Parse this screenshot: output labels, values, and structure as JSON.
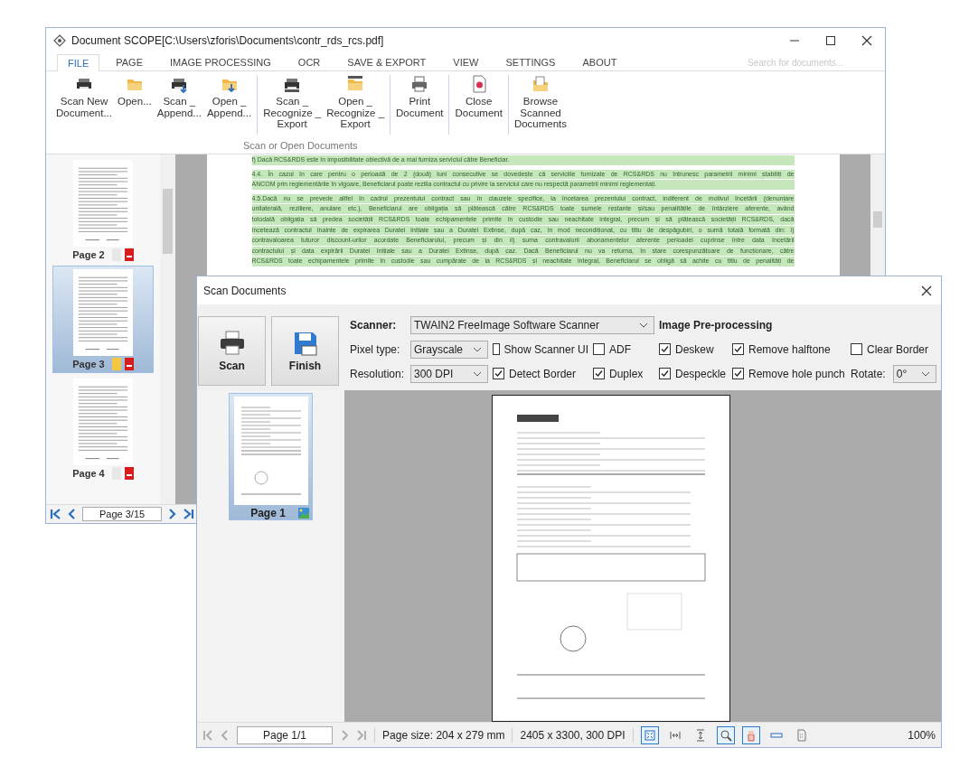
{
  "main_window": {
    "title": "Document SCOPE[C:\\Users\\zforis\\Documents\\contr_rds_rcs.pdf]",
    "tabs": [
      {
        "label": "FILE",
        "selected": true
      },
      {
        "label": "PAGE",
        "selected": false
      },
      {
        "label": "IMAGE PROCESSING",
        "selected": false
      },
      {
        "label": "OCR",
        "selected": false
      },
      {
        "label": "SAVE & EXPORT",
        "selected": false
      },
      {
        "label": "VIEW",
        "selected": false
      },
      {
        "label": "SETTINGS",
        "selected": false
      },
      {
        "label": "ABOUT",
        "selected": false
      }
    ],
    "search": {
      "placeholder": "Search for documents..."
    },
    "ribbon": {
      "caption": "Scan or Open Documents",
      "groups": [
        {
          "buttons": [
            {
              "label": "Scan New\nDocument...",
              "kind": "scanner"
            },
            {
              "label": "Open...",
              "kind": "folder"
            },
            {
              "label": "Scan _\nAppend...",
              "kind": "scanner-append"
            },
            {
              "label": "Open _\nAppend...",
              "kind": "folder-append"
            }
          ]
        },
        {
          "buttons": [
            {
              "label": "Scan _\nRecognize _\nExport",
              "kind": "scanner-numbered"
            },
            {
              "label": "Open _\nRecognize _\nExport",
              "kind": "folder-numbered"
            }
          ]
        },
        {
          "buttons": [
            {
              "label": "Print\nDocument",
              "kind": "printer"
            }
          ]
        },
        {
          "buttons": [
            {
              "label": "Close\nDocument",
              "kind": "close-document"
            }
          ]
        },
        {
          "buttons": [
            {
              "label": "Browse\nScanned\nDocuments",
              "kind": "browse"
            }
          ]
        }
      ]
    },
    "thumbnails": [
      {
        "label": "Page 2",
        "selected": false,
        "ocr_done": false
      },
      {
        "label": "Page 3",
        "selected": true,
        "ocr_done": true
      },
      {
        "label": "Page 4",
        "selected": false,
        "ocr_done": false
      }
    ],
    "page_nav": "Page 3/15",
    "document_lines": [
      {
        "text": "f) Dacă RCS&RDS este în imposibilitate obiectivă de a mai furniza serviciul către Beneficiar.",
        "last": true
      },
      {
        "text": "4.4. În cazul în care pentru o perioadă de 2 (două) luni consecutive se dovedește că serviciile furnizate de RCS&RDS nu întrunesc parametrii minimi stabiliți de",
        "last": false
      },
      {
        "text": "ANCOM prin reglementările în vigoare, Beneficiarul poate rezilia contractul cu privire la serviciul care nu respectă parametrii minimi reglementați.",
        "last": true
      },
      {
        "text": "4.5.Dacă nu se prevede altfel în cadrul prezentului contract sau în clauzele specifice, la încetarea prezentului contract, indiferent de motivul încetării (denunțare",
        "last": false
      },
      {
        "text": "unilaterală, reziliere, anulare etc.), Beneficiarul are obligația să plătească către RCS&RDS toate sumele restante și/sau penalitățile de întârziere aferente, având",
        "last": false
      },
      {
        "text": "totodată obligația să predea societății RCS&RDS toate echipamentele primite în custodie sau neachitate integral, precum și să plătească societății RCS&RDS, dacă",
        "last": false
      },
      {
        "text": "încetează contractul înainte de expirarea Duratei Inițiale sau a Duratei Extinse, după caz, în mod necondiționat, cu titlu de despăgubiri, o sumă totală formată din: i)",
        "last": false
      },
      {
        "text": "contravaloarea tuturor discount-urilor acordate Beneficiarului, precum și din ii) suma contravalorii abonamentelor aferente perioadei cuprinse între data încetării",
        "last": false
      },
      {
        "text": "contractului și data expirării Duratei Inițiale sau a Duratei Extinse, după caz. Dacă Beneficiarul nu va returna, în stare corespunzătoare de funcționare, către",
        "last": false
      },
      {
        "text": "RCS&RDS toate echipamentele primite în custodie sau cumpărate de la RCS&RDS și neachitate integral, Beneficiarul se obligă să achite cu titlu de penalități de",
        "last": false
      }
    ]
  },
  "dialog": {
    "title": "Scan Documents",
    "buttons": [
      {
        "label": "Scan",
        "kind": "printer"
      },
      {
        "label": "Finish",
        "kind": "save"
      }
    ],
    "scanner": {
      "label": "Scanner:",
      "value": "TWAIN2 FreeImage Software Scanner"
    },
    "heading": "Image Pre-processing",
    "pixel_type": {
      "label": "Pixel type:",
      "value": "Grayscale"
    },
    "resolution": {
      "label": "Resolution:",
      "value": "300 DPI"
    },
    "options_row_1": [
      {
        "label": "Show Scanner UI",
        "checked": false
      },
      {
        "label": "ADF",
        "checked": false
      },
      {
        "label": "Deskew",
        "checked": true
      },
      {
        "label": "Remove halftone",
        "checked": true
      },
      {
        "label": "Clear Border",
        "checked": false
      }
    ],
    "options_row_2": [
      {
        "label": "Detect Border",
        "checked": true
      },
      {
        "label": "Duplex",
        "checked": true
      },
      {
        "label": "Despeckle",
        "checked": true
      },
      {
        "label": "Remove hole punch",
        "checked": true
      }
    ],
    "rotate": {
      "label": "Rotate:",
      "value": "0°"
    },
    "thumbnails": [
      {
        "label": "Page 1",
        "selected": true
      }
    ],
    "status_bar": {
      "page": "Page 1/1",
      "page_size": "Page size: 204 x 279 mm",
      "dimensions": "2405 x 3300, 300 DPI",
      "zoom": "100%",
      "tools": [
        {
          "kind": "fit-page",
          "selected": true
        },
        {
          "kind": "fit-width",
          "selected": false
        },
        {
          "kind": "fit-height",
          "selected": false
        },
        {
          "kind": "zoom",
          "selected": true
        },
        {
          "kind": "hand",
          "selected": true
        },
        {
          "kind": "width-bar",
          "selected": false
        },
        {
          "kind": "page",
          "selected": false
        }
      ]
    }
  }
}
